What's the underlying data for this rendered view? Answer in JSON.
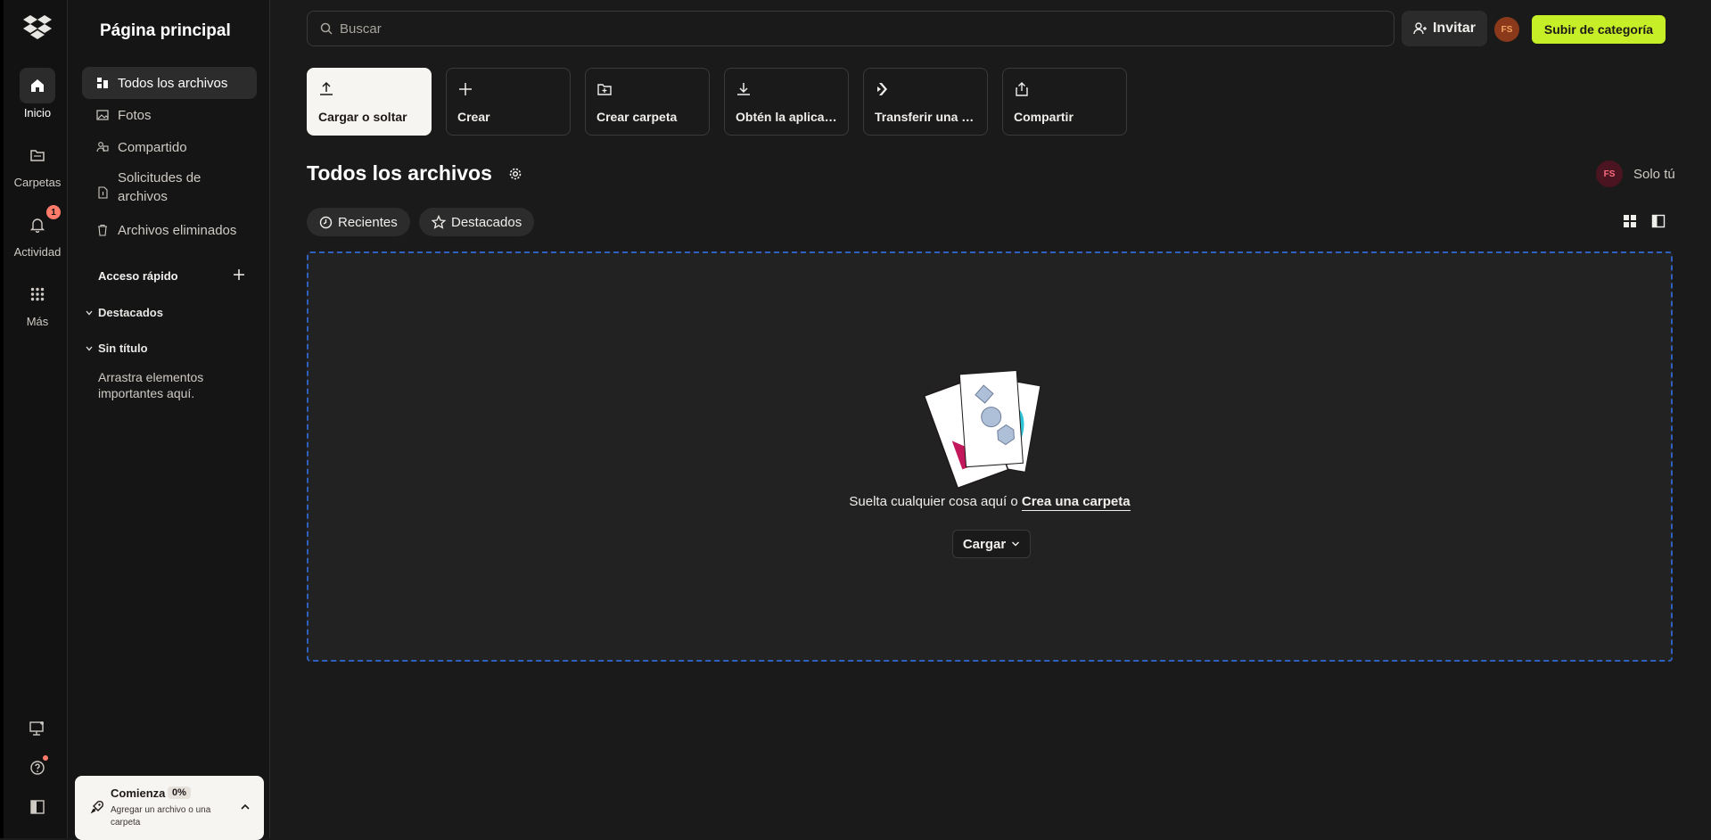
{
  "rail": {
    "items": [
      {
        "label": "Inicio",
        "icon": "home-icon"
      },
      {
        "label": "Carpetas",
        "icon": "folder-icon"
      },
      {
        "label": "Actividad",
        "icon": "bell-icon",
        "badge": "1"
      },
      {
        "label": "Más",
        "icon": "grid-icon"
      }
    ]
  },
  "sidebar": {
    "title": "Página principal",
    "items": [
      {
        "label": "Todos los archivos"
      },
      {
        "label": "Fotos"
      },
      {
        "label": "Compartido"
      },
      {
        "label": "Solicitudes de archivos"
      },
      {
        "label": "Archivos eliminados"
      }
    ],
    "quick_access": "Acceso rápido",
    "groups": [
      "Destacados",
      "Sin título"
    ],
    "hint": "Arrastra elementos importantes aquí."
  },
  "start_card": {
    "title": "Comienza",
    "percent": "0%",
    "subtitle": "Agregar un archivo o una carpeta"
  },
  "topbar": {
    "search_placeholder": "Buscar",
    "invite_label": "Invitar",
    "avatar_initials": "FS",
    "upgrade_label": "Subir de categoría"
  },
  "tiles": [
    {
      "label": "Cargar o soltar",
      "icon": "upload-icon"
    },
    {
      "label": "Crear",
      "icon": "plus-icon"
    },
    {
      "label": "Crear carpeta",
      "icon": "folder-plus-icon"
    },
    {
      "label": "Obtén la aplicación",
      "icon": "download-icon"
    },
    {
      "label": "Transferir una copia",
      "icon": "transfer-icon"
    },
    {
      "label": "Compartir",
      "icon": "share-icon"
    }
  ],
  "main": {
    "title": "Todos los archivos",
    "owner_initials": "FS",
    "owner_label": "Solo tú",
    "chips": [
      "Recientes",
      "Destacados"
    ],
    "drop_text": "Suelta cualquier cosa aquí o",
    "drop_link": "Crea una carpeta",
    "upload_button": "Cargar"
  },
  "colors": {
    "accent_upgrade": "#c6ef28",
    "dropzone_border": "#2f5fbf",
    "badge": "#ff7c6b"
  }
}
